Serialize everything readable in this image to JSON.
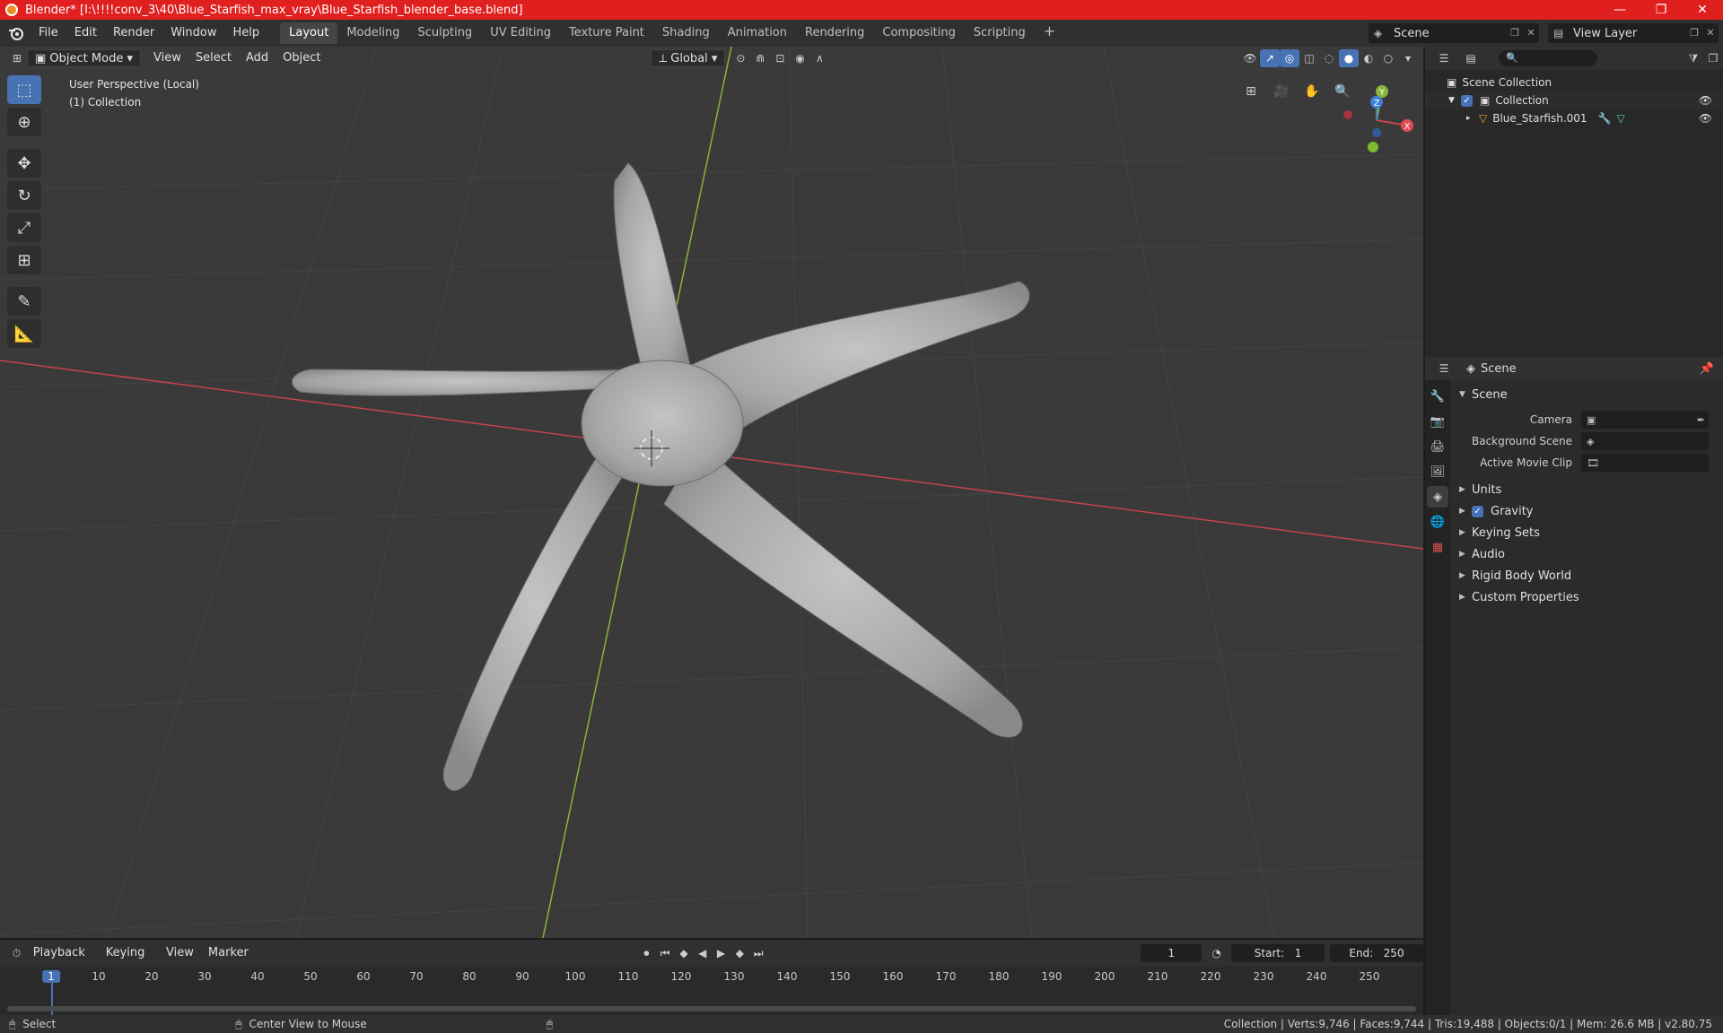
{
  "window": {
    "title": "Blender* [I:\\!!!!conv_3\\40\\Blue_Starfish_max_vray\\Blue_Starfish_blender_base.blend]",
    "minimize": "—",
    "maximize": "❐",
    "close": "✕"
  },
  "menubar": {
    "menus": [
      "File",
      "Edit",
      "Render",
      "Window",
      "Help"
    ],
    "workspaces": [
      "Layout",
      "Modeling",
      "Sculpting",
      "UV Editing",
      "Texture Paint",
      "Shading",
      "Animation",
      "Rendering",
      "Compositing",
      "Scripting"
    ],
    "active_workspace": "Layout",
    "add_workspace": "+",
    "scene": "Scene",
    "view_layer": "View Layer"
  },
  "viewport": {
    "mode": "Object Mode",
    "menus": [
      "View",
      "Select",
      "Add",
      "Object"
    ],
    "orientation": "Global",
    "overlay_line1": "User Perspective (Local)",
    "overlay_line2": "(1) Collection",
    "gizmo": {
      "x": "X",
      "y": "Y",
      "z": "Z"
    },
    "colors": {
      "background": "#3a3a3a",
      "x_axis": "#c8434a",
      "y_axis": "#87b63a",
      "accent": "#4772b3"
    }
  },
  "timeline": {
    "menus": [
      "Playback",
      "Keying",
      "View",
      "Marker"
    ],
    "current_frame": "1",
    "start_label": "Start:",
    "start": "1",
    "end_label": "End:",
    "end": "250",
    "ticks": [
      "1",
      "10",
      "20",
      "30",
      "40",
      "50",
      "60",
      "70",
      "80",
      "90",
      "100",
      "110",
      "120",
      "130",
      "140",
      "150",
      "160",
      "170",
      "180",
      "190",
      "200",
      "210",
      "220",
      "230",
      "240",
      "250"
    ]
  },
  "statusbar": {
    "select": "Select",
    "center": "Center View to Mouse",
    "stats": "Collection | Verts:9,746 | Faces:9,744 | Tris:19,488 | Objects:0/1 | Mem: 26.6 MB | v2.80.75"
  },
  "outliner": {
    "rows": [
      "Scene Collection",
      "Collection",
      "Blue_Starfish.001"
    ]
  },
  "properties": {
    "breadcrumb": "Scene",
    "panel_title": "Scene",
    "fields": [
      {
        "label": "Camera"
      },
      {
        "label": "Background Scene"
      },
      {
        "label": "Active Movie Clip"
      }
    ],
    "subpanels": [
      "Units",
      "Gravity",
      "Keying Sets",
      "Audio",
      "Rigid Body World",
      "Custom Properties"
    ]
  }
}
